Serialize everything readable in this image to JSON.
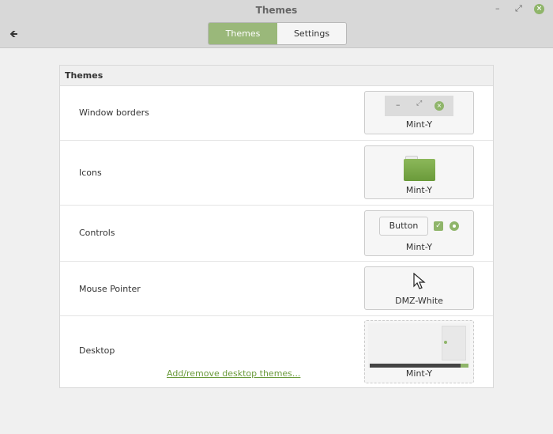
{
  "window": {
    "title": "Themes",
    "minimize": "–",
    "maximize": "⤢",
    "close": "×"
  },
  "toolbar": {
    "back": "🡸",
    "tabs": [
      {
        "label": "Themes",
        "active": true
      },
      {
        "label": "Settings",
        "active": false
      }
    ]
  },
  "panel": {
    "title": "Themes",
    "rows": [
      {
        "label": "Window borders",
        "theme": "Mint-Y"
      },
      {
        "label": "Icons",
        "theme": "Mint-Y"
      },
      {
        "label": "Controls",
        "theme": "Mint-Y",
        "button": "Button"
      },
      {
        "label": "Mouse Pointer",
        "theme": "DMZ-White"
      },
      {
        "label": "Desktop",
        "theme": "Mint-Y",
        "link": "Add/remove desktop themes..."
      }
    ]
  },
  "colors": {
    "accent": "#9ab87a"
  }
}
